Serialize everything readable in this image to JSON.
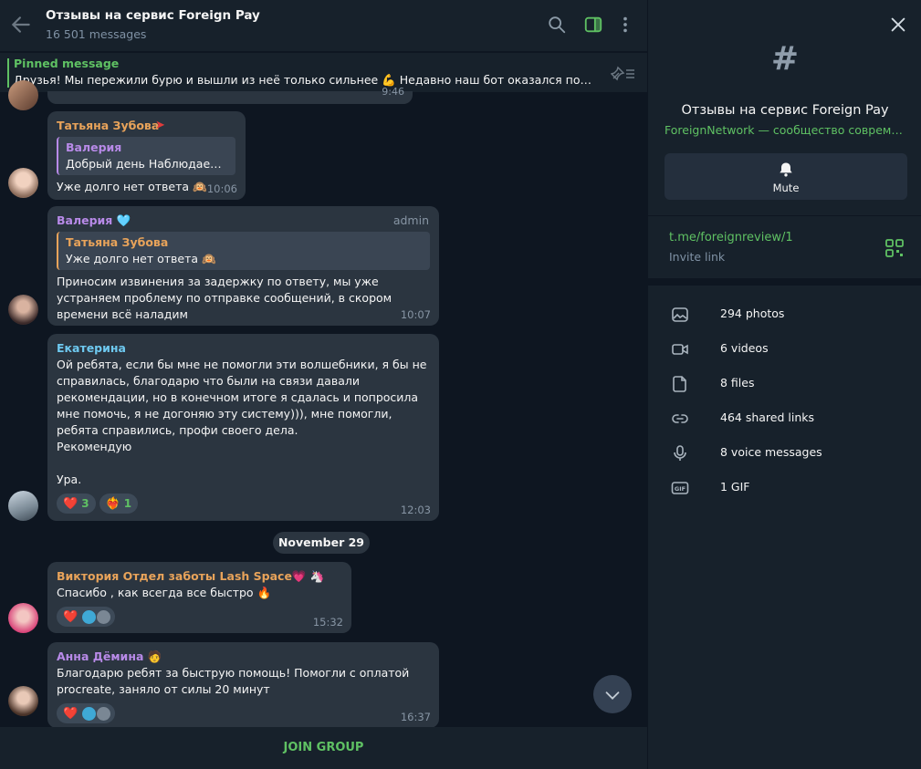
{
  "header": {
    "title": "Отзывы на сервис Foreign Pay",
    "subtitle": "16 501 messages"
  },
  "pinned": {
    "label": "Pinned message",
    "text": "Друзья! Мы пережили бурю и вышли из неё только сильнее 💪  Недавно наш бот оказался под бло..."
  },
  "messages": [
    {
      "sender": "Татьяна Зубова",
      "sender_color": "#e8a35a",
      "reply_name": "Валерия",
      "reply_text": "Добрый день Наблюдаем з...",
      "reply_color": "#b88ae8",
      "text": "Уже долго нет ответа 🙉",
      "time": "10:06"
    },
    {
      "sender": "Валерия 🩵",
      "sender_color": "#b88ae8",
      "badge": "admin",
      "reply_name": "Татьяна Зубова",
      "reply_text": "Уже долго нет ответа 🙉",
      "reply_color": "#e8a35a",
      "text": "Приносим извинения за задержку по ответу, мы уже устраняем проблему по отправке сообщений, в скором времени всё наладим",
      "time": "10:07"
    },
    {
      "sender": "Екатерина",
      "sender_color": "#6ec9f0",
      "text": "Ой ребята, если бы мне не помогли эти волшебники, я бы не справилась, благодарю что были на связи давали рекомендации, но в конечном итоге я сдалась и попросила мне помочь, я не догоняю эту систему))), мне помогли, ребята справились, профи своего дела.\nРекомендую\n\nУра.",
      "reactions": [
        {
          "emoji": "❤️",
          "count": "3"
        },
        {
          "emoji": "❤️‍🔥",
          "count": "1"
        }
      ],
      "time": "12:03"
    },
    {
      "sender": "Виктория Отдел заботы Lash Space💗 🦄",
      "sender_color": "#e8a35a",
      "text": "Спасибо , как всегда все быстро 🔥",
      "reaction_emoji": "❤️",
      "time": "15:32"
    },
    {
      "sender": "Анна Дёмина 🧑",
      "sender_color": "#b88ae8",
      "text": "Благодарю ребят за быструю помощь! Помогли с оплатой procreate, заняло от силы 20 минут",
      "reaction_emoji": "❤️",
      "time": "16:37"
    }
  ],
  "partial_time": "9:46",
  "date_chip": "November 29",
  "join_button": "JOIN GROUP",
  "panel": {
    "title": "Отзывы на сервис Foreign Pay",
    "description": "ForeignNetwork — сообщество современных...",
    "mute_label": "Mute",
    "invite_link": "t.me/foreignreview/1",
    "invite_label": "Invite link",
    "media": [
      {
        "icon": "photo-icon",
        "label": "294 photos"
      },
      {
        "icon": "video-icon",
        "label": "6 videos"
      },
      {
        "icon": "file-icon",
        "label": "8 files"
      },
      {
        "icon": "link-icon",
        "label": "464 shared links"
      },
      {
        "icon": "microphone-icon",
        "label": "8 voice messages"
      },
      {
        "icon": "gif-icon",
        "label": "1 GIF"
      }
    ]
  },
  "colors": {
    "accent": "#5fc163",
    "background": "#0e1621",
    "panel": "#17212b",
    "bubble": "#2b3540"
  }
}
